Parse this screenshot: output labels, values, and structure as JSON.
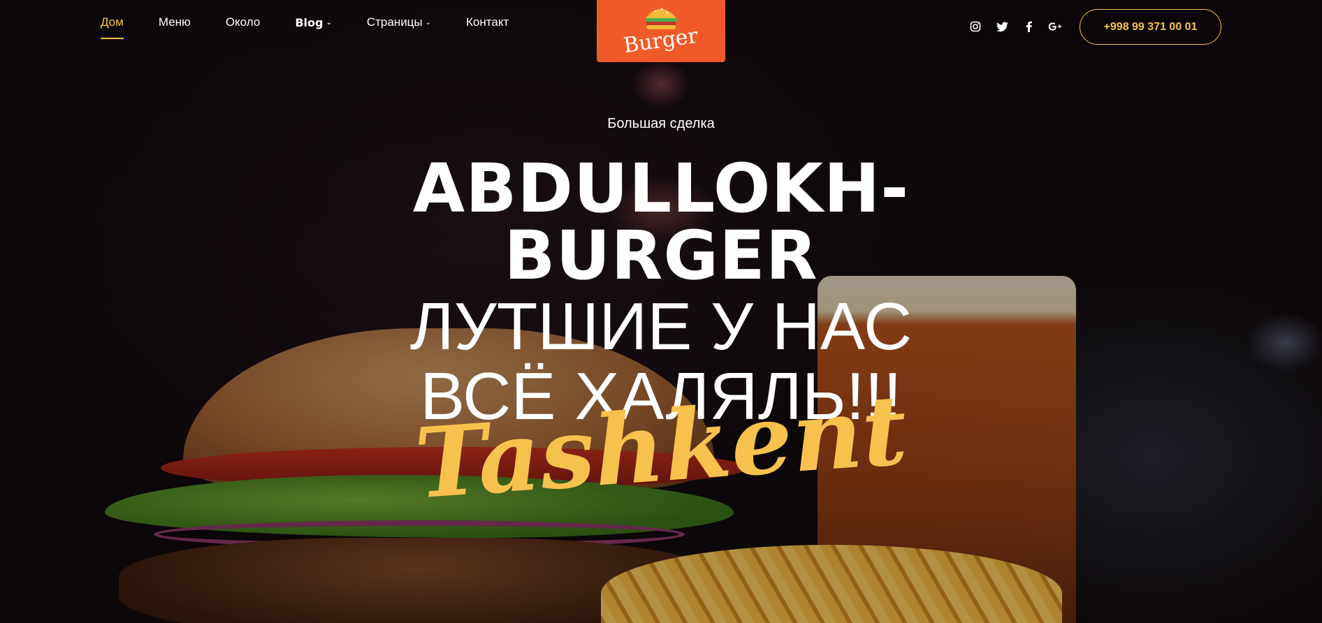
{
  "nav": {
    "items": [
      {
        "label": "Дом"
      },
      {
        "label": "Меню"
      },
      {
        "label": "Около"
      },
      {
        "label": "Blog"
      },
      {
        "label": "Страницы"
      },
      {
        "label": "Контакт"
      }
    ]
  },
  "logo": {
    "text": "Burger"
  },
  "socials": {
    "instagram": "instagram-icon",
    "twitter": "twitter-icon",
    "facebook": "facebook-icon",
    "google_plus": "google-plus-icon"
  },
  "phone": "+998 99 371 00 01",
  "hero": {
    "subtitle": "Большая сделка",
    "title_line1": "ABDULLOKH-",
    "title_line2": "BURGER",
    "tagline_line1": "ЛУТШИЕ У НАС",
    "tagline_line2": "ВСЁ ХАЛЯЛЬ!!!",
    "script": "Tashkent"
  },
  "colors": {
    "accent": "#f6c24d",
    "logo_bg": "#f05a28"
  }
}
